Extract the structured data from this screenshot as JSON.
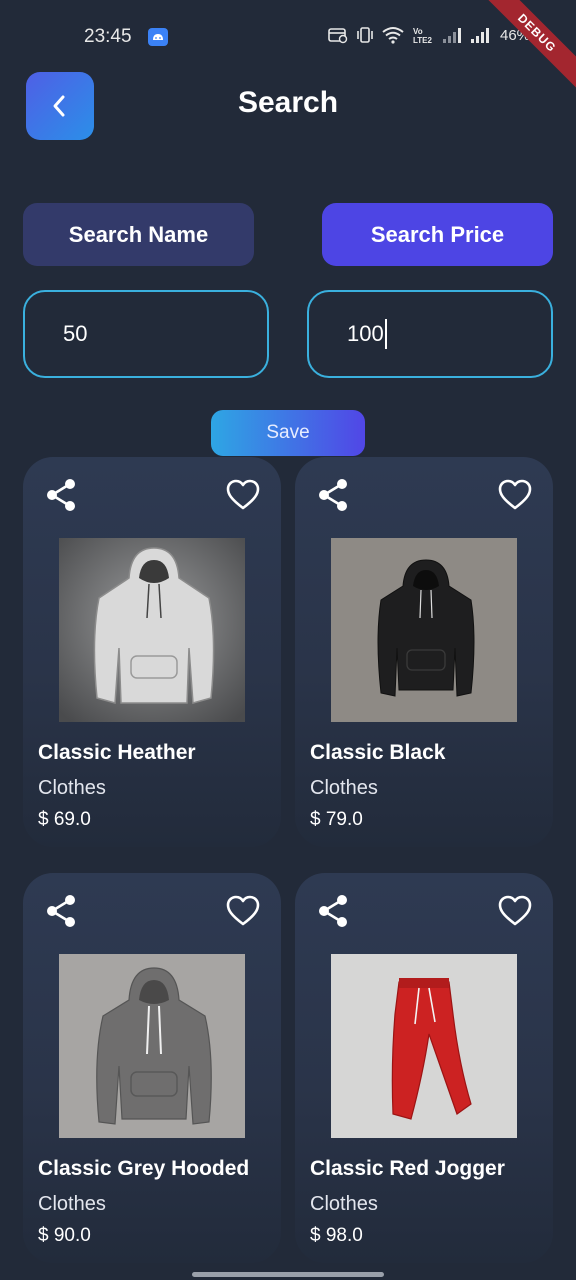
{
  "status_bar": {
    "time": "23:45",
    "battery": "46%",
    "debug_label": "DEBUG",
    "icons": [
      "android-notification-icon",
      "card-icon",
      "vibrate-icon",
      "wifi-icon",
      "volte-icon",
      "signal-icon",
      "signal-icon"
    ]
  },
  "header": {
    "title": "Search",
    "back_icon": "chevron-left-icon"
  },
  "toggles": {
    "name_label": "Search Name",
    "price_label": "Search Price",
    "active": "price"
  },
  "inputs": {
    "min_price_value": "50",
    "max_price_value": "100"
  },
  "save_label": "Save",
  "products": [
    {
      "name": "Classic Heather",
      "category": "Clothes",
      "price": "$ 69.0",
      "image": "grey-hoodie"
    },
    {
      "name": "Classic Black",
      "category": "Clothes",
      "price": "$ 79.0",
      "image": "black-hoodie"
    },
    {
      "name": "Classic Grey Hooded",
      "category": "Clothes",
      "price": "$ 90.0",
      "image": "grey-hoodie"
    },
    {
      "name": "Classic Red Jogger",
      "category": "Clothes",
      "price": "$ 98.0",
      "image": "red-joggers"
    }
  ],
  "colors": {
    "background": "#222a39",
    "accent": "#4d45e4",
    "input_border": "#3ab0de"
  }
}
